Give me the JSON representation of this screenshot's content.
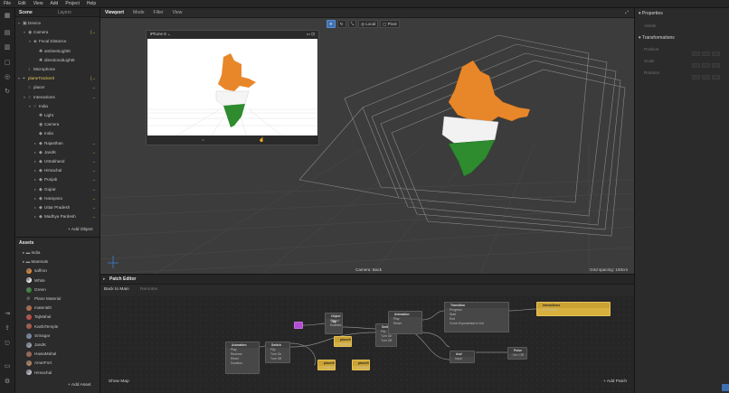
{
  "menubar": [
    "File",
    "Edit",
    "View",
    "Add",
    "Project",
    "Help"
  ],
  "scene": {
    "tabs": [
      "Scene",
      "Layers"
    ],
    "tree": [
      {
        "label": "Device",
        "icon": "device-icon",
        "depth": 0,
        "caret": "▾"
      },
      {
        "label": "Camera",
        "icon": "camera-icon",
        "depth": 1,
        "caret": "▾",
        "arrow": "[→"
      },
      {
        "label": "Focal Distance",
        "icon": "focal-icon",
        "depth": 2,
        "caret": "▾"
      },
      {
        "label": "ambientLight0",
        "icon": "light-icon",
        "depth": 3,
        "caret": ""
      },
      {
        "label": "directionalLight0",
        "icon": "light-icon",
        "depth": 3,
        "caret": ""
      },
      {
        "label": "Microphone",
        "icon": "mic-icon",
        "depth": 1,
        "caret": ""
      },
      {
        "label": "planeTracker0",
        "icon": "tracker-icon",
        "depth": 0,
        "caret": "▾",
        "arrow": "[→",
        "highlight": true
      },
      {
        "label": "placer",
        "icon": "null-icon",
        "depth": 1,
        "caret": "",
        "arrow": "→"
      },
      {
        "label": "Interactions",
        "icon": "null-icon",
        "depth": 1,
        "caret": "▾",
        "arrow": "→"
      },
      {
        "label": "India",
        "icon": "null-icon",
        "depth": 2,
        "caret": "▾"
      },
      {
        "label": "Light",
        "icon": "light-icon",
        "depth": 3,
        "caret": ""
      },
      {
        "label": "Camera",
        "icon": "camera-icon",
        "depth": 3,
        "caret": ""
      },
      {
        "label": "India",
        "icon": "mesh-icon",
        "depth": 3,
        "caret": ""
      },
      {
        "label": "Rajasthan",
        "icon": "mesh-icon",
        "depth": 3,
        "caret": "▸",
        "arrow": "→"
      },
      {
        "label": "JandK",
        "icon": "mesh-icon",
        "depth": 3,
        "caret": "▸",
        "arrow": "→"
      },
      {
        "label": "Uttrakhand",
        "icon": "mesh-icon",
        "depth": 3,
        "caret": "▸",
        "arrow": "→"
      },
      {
        "label": "Himachal",
        "icon": "mesh-icon",
        "depth": 3,
        "caret": "▸",
        "arrow": "→"
      },
      {
        "label": "Punjab",
        "icon": "mesh-icon",
        "depth": 3,
        "caret": "▸",
        "arrow": "→"
      },
      {
        "label": "Gujrat",
        "icon": "mesh-icon",
        "depth": 3,
        "caret": "▸",
        "arrow": "→"
      },
      {
        "label": "Harayana",
        "icon": "mesh-icon",
        "depth": 3,
        "caret": "▸",
        "arrow": "→"
      },
      {
        "label": "Uttar Pradesh",
        "icon": "mesh-icon",
        "depth": 3,
        "caret": "▸",
        "arrow": "→"
      },
      {
        "label": "Madhya Pardesh",
        "icon": "mesh-icon",
        "depth": 3,
        "caret": "▸",
        "arrow": "→"
      }
    ],
    "add_object": "Add Object"
  },
  "assets": {
    "title": "Assets",
    "items": [
      {
        "label": "India",
        "icon": "folder-icon",
        "color": ""
      },
      {
        "label": "Materials",
        "icon": "folder-icon",
        "color": ""
      },
      {
        "label": "saffron",
        "icon": "material-icon",
        "color": "#e8872a"
      },
      {
        "label": "White",
        "icon": "material-icon",
        "color": "#f2f2f2"
      },
      {
        "label": "Green",
        "icon": "material-icon",
        "color": "#2f8a2f"
      },
      {
        "label": "Plane Material",
        "icon": "material-icon",
        "color": "#222222"
      },
      {
        "label": "material0",
        "icon": "material-icon",
        "color": "#c86a3a"
      },
      {
        "label": "TajMahal",
        "icon": "material-icon",
        "color": "#d0443a"
      },
      {
        "label": "KashiTemple",
        "icon": "material-icon",
        "color": "#b9553e"
      },
      {
        "label": "Srinagar",
        "icon": "material-icon",
        "color": "#7a8fb0"
      },
      {
        "label": "JandK",
        "icon": "material-icon",
        "color": "#9aa4b5"
      },
      {
        "label": "HawaMahal",
        "icon": "material-icon",
        "color": "#a8654a"
      },
      {
        "label": "AmerFort",
        "icon": "material-icon",
        "color": "#b88760"
      },
      {
        "label": "Himachal",
        "icon": "material-icon",
        "color": "#c6c6d6"
      }
    ],
    "add_asset": "Add Asset"
  },
  "viewport": {
    "tabs": [
      "Viewport",
      "Mode",
      "Filter",
      "View"
    ],
    "tools": [
      "Local",
      "Pivot"
    ],
    "device": "iPhone 8",
    "camera_label": "Camera: Back",
    "grid_label": "Grid spacing: 100cm"
  },
  "properties": {
    "title": "Properties",
    "visible_label": "Visible",
    "transformations": "Transformations",
    "rows": [
      "Position",
      "Scale",
      "Rotation"
    ]
  },
  "patch": {
    "title": "Patch Editor",
    "back": "Back to Main",
    "crumb": "Remotes",
    "show_map": "Show Map",
    "add_patch": "Add Patch",
    "nodes": [
      {
        "id": "object-tap",
        "title": "Object Tap",
        "ports": [
          "Object",
          "Enabled"
        ]
      },
      {
        "id": "animation-1",
        "title": "Animation",
        "ports": [
          "Play",
          "Reverse",
          "Reset",
          "Duration"
        ]
      },
      {
        "id": "switch-1",
        "title": "Switch",
        "ports": [
          "Flip",
          "Turn On",
          "Turn Off"
        ]
      },
      {
        "id": "switch-2",
        "title": "Switch",
        "ports": [
          "Flip",
          "Turn On",
          "Turn Off"
        ]
      },
      {
        "id": "animation-2",
        "title": "Animation",
        "ports": [
          "Play",
          "Reset"
        ]
      },
      {
        "id": "transition",
        "title": "Transition",
        "ports": [
          "Progress",
          "Start",
          "End",
          "Curve"
        ]
      },
      {
        "id": "and",
        "title": "And",
        "ports": [
          "Input"
        ]
      },
      {
        "id": "pulse",
        "title": "Pulse",
        "ports": [
          "On / Off"
        ]
      },
      {
        "id": "placer-1",
        "title": "placer0",
        "ports": [
          "Position"
        ]
      },
      {
        "id": "placer-2",
        "title": "placer0",
        "ports": [
          "Position"
        ]
      },
      {
        "id": "placer-3",
        "title": "placer0",
        "ports": [
          "Position"
        ]
      },
      {
        "id": "animate-out",
        "title": "Interactions",
        "ports": [
          "3D Position"
        ]
      }
    ],
    "transition_curve": "Exponential In Out"
  },
  "colors": {
    "saffron": "#e8872a",
    "white": "#f5f5f5",
    "green": "#2e8b2e",
    "accent": "#3d6fb3",
    "node_yellow": "#d7b03d",
    "node_purple": "#b04fd1"
  }
}
